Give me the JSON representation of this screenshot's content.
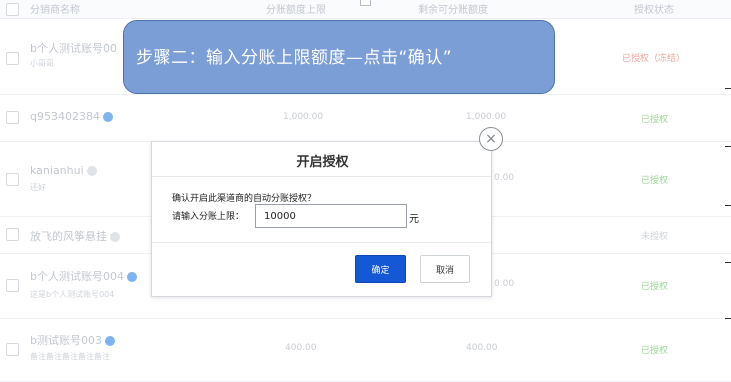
{
  "table": {
    "headers": [
      "分销商名称",
      "分账额度上限",
      "剩余可分账额度",
      "授权状态"
    ],
    "rows": [
      {
        "name": "b个人测试账号00",
        "sub": "小哥哥",
        "limit": "",
        "remain": "",
        "status": "已授权（冻结）"
      },
      {
        "name": "q953402384",
        "sub": "",
        "limit": "1,000.00",
        "remain": "1,000.00",
        "status": "已授权"
      },
      {
        "name": "kanianhui",
        "sub": "还好",
        "limit": "",
        "remain": "0.00",
        "status": "已授权"
      },
      {
        "name": "放飞的风筝悬挂",
        "sub": "",
        "limit": "",
        "remain": "",
        "status": "未授权"
      },
      {
        "name": "b个人测试账号004",
        "sub": "这是b个人测试账号004",
        "limit": "",
        "remain": "0.00",
        "status": "已授权"
      },
      {
        "name": "b测试账号003",
        "sub": "备注备注备注备注备注",
        "limit": "400.00",
        "remain": "400.00",
        "status": "已授权"
      }
    ]
  },
  "banner": {
    "text": "步骤二：输入分账上限额度—点击“确认”"
  },
  "modal": {
    "title": "开启授权",
    "confirm_text": "确认开启此渠道商的自动分账授权？",
    "limit_label": "请输入分账上限：",
    "limit_value": "10000",
    "unit": "元",
    "ok_label": "确定",
    "cancel_label": "取消",
    "close_glyph": "×"
  },
  "colors": {
    "primary": "#1558d6",
    "banner": "#7b9ed6",
    "status_ok": "#9fd79a"
  }
}
